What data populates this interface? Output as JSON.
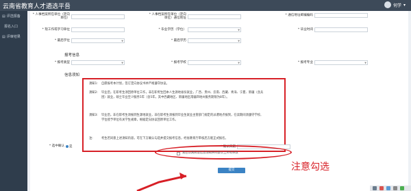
{
  "app": {
    "title": "云南省教育人才遴选平台",
    "menu_icon": "bars-icon"
  },
  "user": {
    "name": "何学"
  },
  "sidebar": {
    "items": [
      {
        "label": "评选报备",
        "sub": false
      },
      {
        "label": "报名入口",
        "sub": true
      },
      {
        "label": "评审结果",
        "sub": false
      }
    ]
  },
  "form": {
    "row1": [
      {
        "label": "* 人事档案所在单位（定向单位）",
        "value": ""
      },
      {
        "label": "* 人事档案所在单位（定向单位）通信地址",
        "value": ""
      },
      {
        "label": "* 通信地址邮编编码",
        "value": ""
      }
    ],
    "row2": [
      {
        "label": "* 现工作或学习单位",
        "value": ""
      },
      {
        "label": "* 毕业学历（学位）",
        "value": ""
      },
      {
        "label": "* 毕业时间",
        "value": ""
      }
    ],
    "row3": [
      {
        "label": "* 最后学位",
        "value": ""
      },
      {
        "label": "* 最后学历",
        "value": ""
      }
    ],
    "section_apply": "报考信息",
    "row4": [
      {
        "label": "* 报考类型",
        "value": ""
      },
      {
        "label": "* 报考学校",
        "value": ""
      },
      {
        "label": "* 报考专业",
        "value": ""
      }
    ],
    "section_notice": "信息须知",
    "notices": [
      {
        "key": "须知1:",
        "text": "自愿报考本计划，签订定向协议书并严格遵守协议。"
      },
      {
        "key": "须知2:",
        "text": "毕业后，在职考生须回原单位工作，非在职考生回本人生源地省份就业，广西、贵州、云南、西藏、青海、宁夏、新疆（含兵团）就业，硕士毕业至少服务5年（含5年，其中西藏地区、新疆地区南疆四地州服务期限为8年）。"
      },
      {
        "key": "须知3:",
        "text": "毕业后，非在职考生须报到生源地就业，非在职考生须报到毕业生就业主管部门规定的派遣地点报到，在读期间须遵守学校、学位授予单位有关学生规章，根据定向协议回原单位工作。"
      },
      {
        "key": "注:",
        "text": "考生若同意上述须知内容，可在下方确认勾选并提交报考信息，经省教育厅审核后方能正式报名。"
      }
    ],
    "selection_label": "* 选中确认",
    "selection_value": "是",
    "confirm_label": "* 确认日期",
    "confirm_value": "",
    "agree_text": "我已认真阅读信息须知并同意以上所有条款",
    "submit_label": "提交"
  },
  "annotation": {
    "text": "注意勾选",
    "color": "#d71f26"
  }
}
